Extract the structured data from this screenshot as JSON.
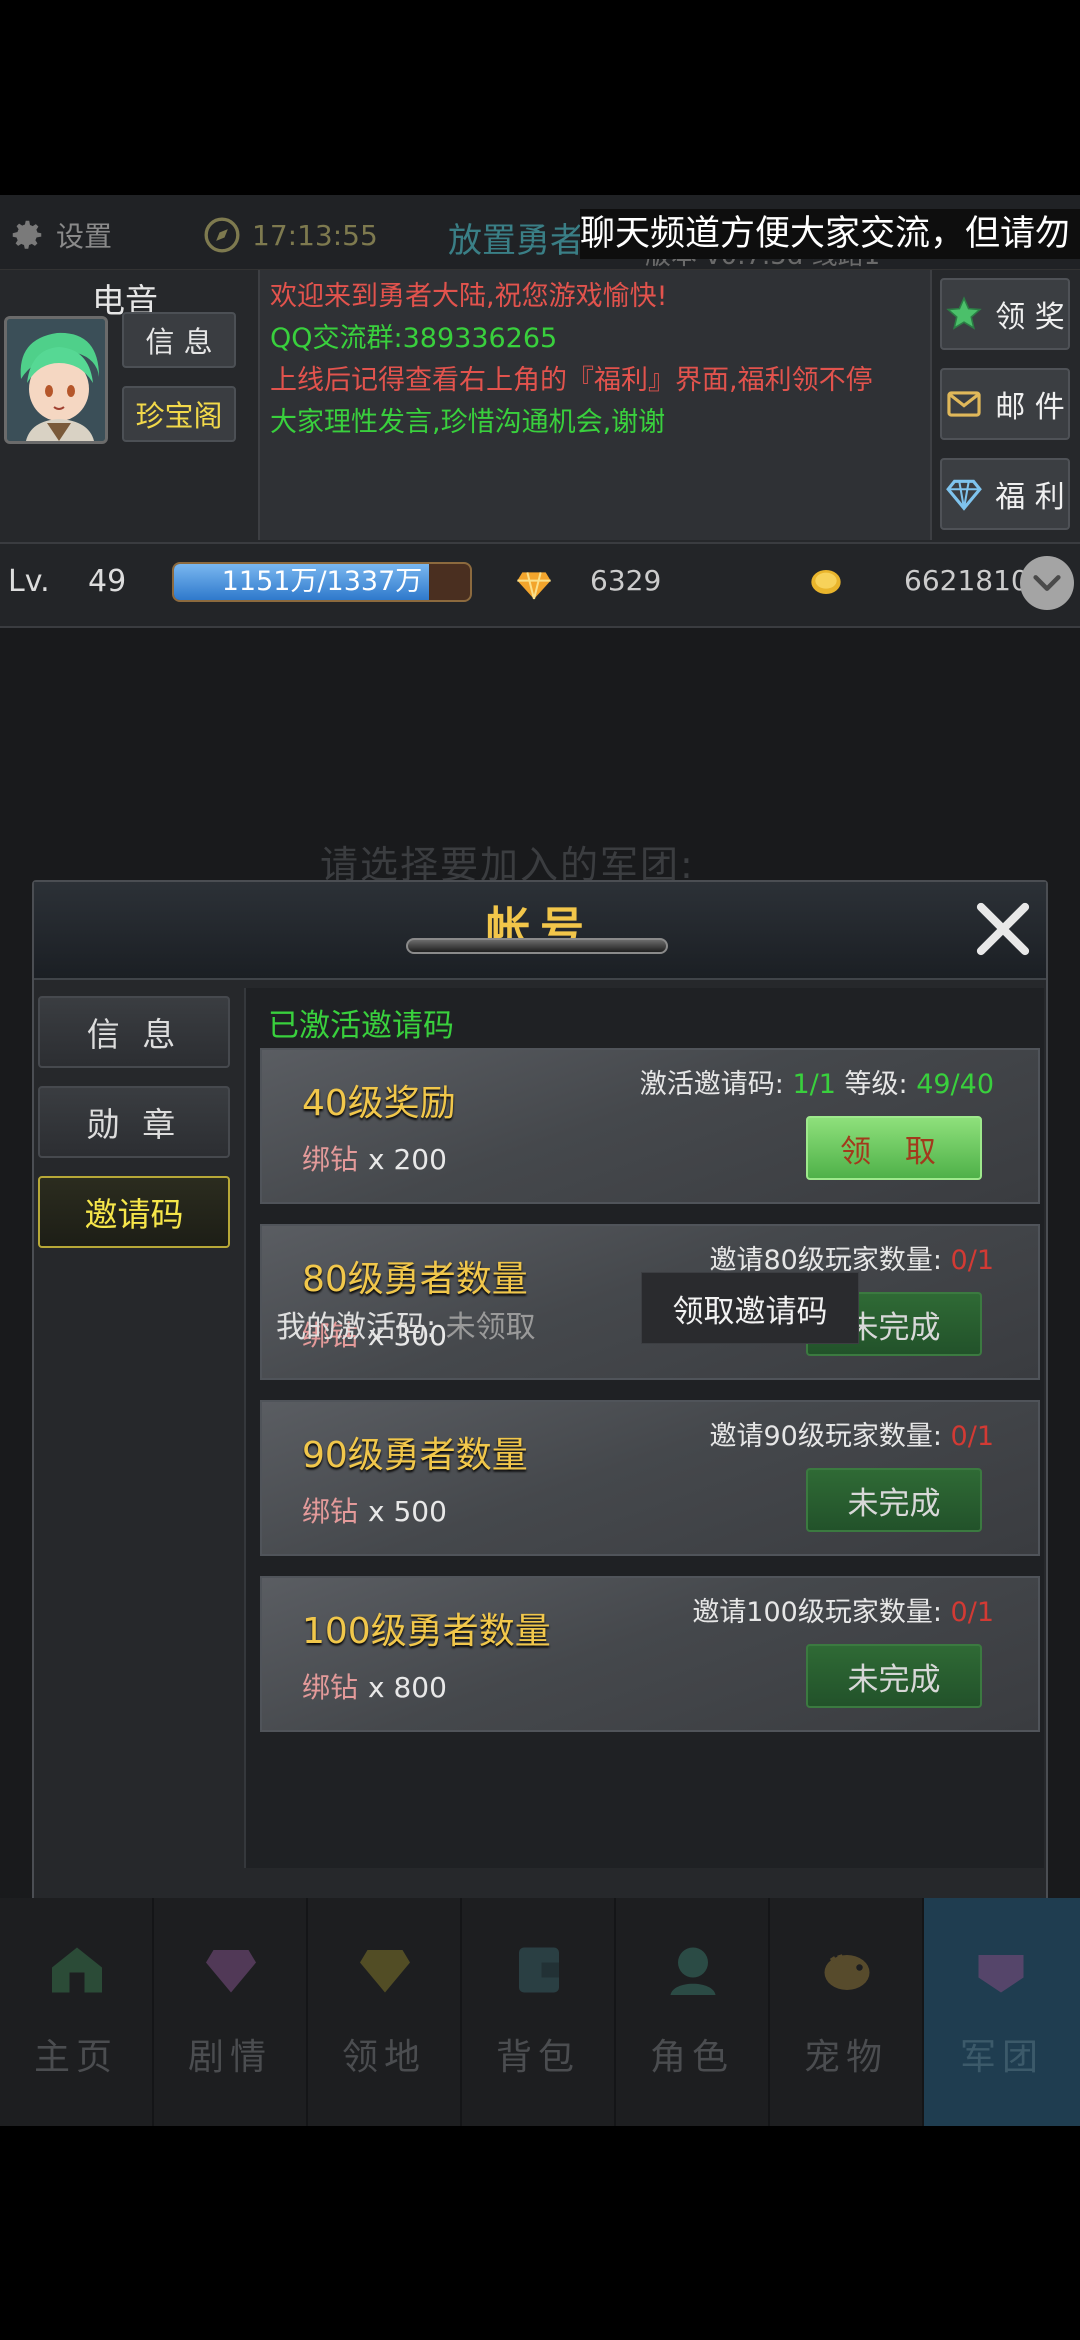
{
  "statusbar": {
    "settings_label": "设置",
    "time": "17:13:55",
    "game_title": "放置勇者",
    "version": "版本 v0.7.5d  线路1",
    "marquee": "聊天频道方便大家交流，但请勿"
  },
  "player": {
    "nickname": "电音",
    "info_button": "信 息",
    "treasure_button": "珍宝阁",
    "level_label": "Lv.",
    "level": "49",
    "exp_text": "1151万/1337万",
    "exp_fraction": 0.861,
    "diamonds": "6329",
    "coins": "6621810"
  },
  "chat": {
    "messages": [
      {
        "text": "欢迎来到勇者大陆,祝您游戏愉快!",
        "color": "#e2534d"
      },
      {
        "text": "QQ交流群:389336265",
        "color": "#39d03d"
      },
      {
        "text": "上线后记得查看右上角的『福利』界面,福利领不停",
        "color": "#e2534d"
      },
      {
        "text": "大家理性发言,珍惜沟通机会,谢谢",
        "color": "#39d03d"
      }
    ]
  },
  "side_buttons": {
    "reward": "领 奖",
    "mail": "邮 件",
    "welfare": "福 利"
  },
  "background": {
    "prompt": "请选择要加入的军团:"
  },
  "modal": {
    "title": "帐号",
    "tabs": [
      "信 息",
      "勋 章",
      "邀请码"
    ],
    "active_tab": 2,
    "activated_title": "已激活邀请码",
    "my_code_label": "我的激活码:",
    "my_code_status": "未领取",
    "get_code_button": "领取邀请码",
    "cards": [
      {
        "name": "40级奖励",
        "reward_label": "绑钻",
        "reward_amount": "x 200",
        "cond_label": "激活邀请码:",
        "cond_value1": "1/1",
        "cond_label2": "等级:",
        "cond_value2": "49/40",
        "button": "领 取"
      },
      {
        "name": "80级勇者数量",
        "reward_label": "绑钻",
        "reward_amount": "x 300",
        "cond_label": "邀请80级玩家数量:",
        "cond_value": "0/1",
        "button": "未完成"
      },
      {
        "name": "90级勇者数量",
        "reward_label": "绑钻",
        "reward_amount": "x 500",
        "cond_label": "邀请90级玩家数量:",
        "cond_value": "0/1",
        "button": "未完成"
      },
      {
        "name": "100级勇者数量",
        "reward_label": "绑钻",
        "reward_amount": "x 800",
        "cond_label": "邀请100级玩家数量:",
        "cond_value": "0/1",
        "button": "未完成"
      }
    ]
  },
  "nav": {
    "items": [
      "主页",
      "剧情",
      "领地",
      "背包",
      "角色",
      "宠物",
      "军团"
    ],
    "active": 6
  },
  "colors": {
    "accent_gold": "#f1c74b",
    "accent_green": "#39d03d",
    "accent_red": "#e2534d"
  }
}
